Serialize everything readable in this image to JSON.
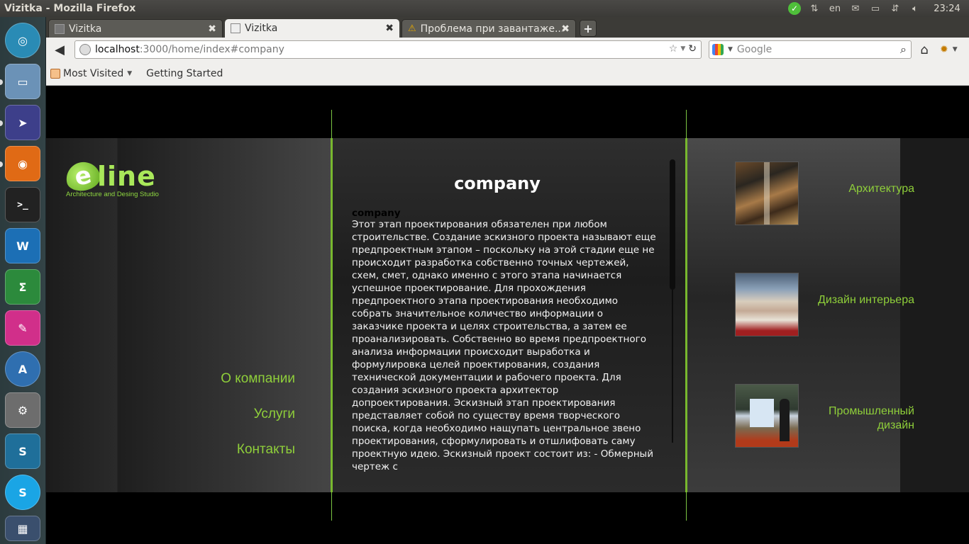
{
  "top_panel": {
    "window_title": "Vizitka - Mozilla Firefox",
    "keyboard_layout": "en",
    "clock": "23:24"
  },
  "launcher": {
    "items": [
      {
        "name": "dash-home",
        "color": "#2a8bb5"
      },
      {
        "name": "files",
        "color": "#6b92b7"
      },
      {
        "name": "remmina",
        "color": "#3d3f8a"
      },
      {
        "name": "firefox",
        "color": "#e06a15"
      },
      {
        "name": "terminal",
        "color": "#222222"
      },
      {
        "name": "libreoffice-writer",
        "color": "#1c6fb5"
      },
      {
        "name": "libreoffice-calc",
        "color": "#2c8a3c"
      },
      {
        "name": "libreoffice-draw",
        "color": "#d12f8a"
      },
      {
        "name": "software-center",
        "color": "#2f6fb0"
      },
      {
        "name": "system-settings",
        "color": "#6d6d6d"
      },
      {
        "name": "skype-like-app",
        "color": "#1f6f9a"
      },
      {
        "name": "skype",
        "color": "#1aa5e5"
      },
      {
        "name": "workspace-switcher",
        "color": "#3a4f6d"
      }
    ]
  },
  "browser": {
    "tabs": [
      {
        "label": "Vizitka",
        "state": "inactive"
      },
      {
        "label": "Vizitka",
        "state": "active"
      },
      {
        "label": "Проблема при завантаже...",
        "state": "inactive"
      }
    ],
    "url_host": "localhost",
    "url_rest": ":3000/home/index#company",
    "search_placeholder": "Google",
    "bookmarks": [
      "Most Visited",
      "Getting Started"
    ]
  },
  "site": {
    "logo_word": "line",
    "logo_e": "e",
    "logo_tagline": "Architecture and Desing Studio",
    "left_nav": [
      "О компании",
      "Услуги",
      "Контакты"
    ],
    "content_title": "company",
    "content_heading": "company",
    "content_body": "Этот этап проектирования обязателен при любом строительстве. Создание эскизного проекта называют еще предпроектным этапом – поскольку на этой стадии еще не происходит разработка собственно точных чертежей, схем, смет, однако именно с этого этапа начинается успешное проектирование. Для прохождения предпроектного этапа проектирования необходимо собрать значительное количество информации о заказчике проекта и целях строительства, а затем ее проанализировать. Собственно во время предпроектного анализа информации происходит выработка и формулировка целей проектирования, создания технической документации и рабочего проекта. Для создания эскизного проекта архитектор допроектирования. Эскизный этап проектирования представляет собой по существу время творческого поиска, когда необходимо нащупать центральное звено проектирования, сформулировать и отшлифовать саму проектную идею. Эскизный проект состоит из: - Обмерный чертеж с",
    "right_nav": [
      "Архитектура",
      "Дизайн интерьера",
      "Промышленный дизайн"
    ],
    "accent_color": "#8fcf3a"
  }
}
